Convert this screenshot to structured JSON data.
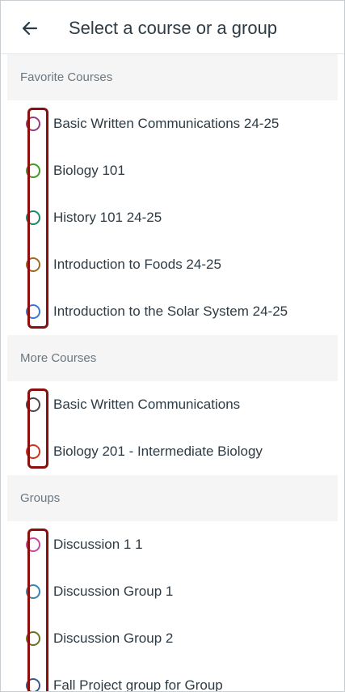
{
  "header": {
    "title": "Select a course or a group"
  },
  "sections": [
    {
      "title": "Favorite Courses",
      "items": [
        {
          "label": "Basic Written Communications 24-25",
          "color": "#8f3f7c"
        },
        {
          "label": "Biology 101",
          "color": "#3f9a2a"
        },
        {
          "label": "History 101 24-25",
          "color": "#198a6e"
        },
        {
          "label": "Introduction to Foods 24-25",
          "color": "#9b6b22"
        },
        {
          "label": "Introduction to the Solar System  24-25",
          "color": "#3a7ad4"
        }
      ]
    },
    {
      "title": "More Courses",
      "items": [
        {
          "label": "Basic Written Communications",
          "color": "#46464e"
        },
        {
          "label": "Biology 201 - Intermediate Biology",
          "color": "#c9381e"
        }
      ]
    },
    {
      "title": "Groups",
      "items": [
        {
          "label": "Discussion 1 1",
          "color": "#c34aa0"
        },
        {
          "label": "Discussion Group 1",
          "color": "#3a84b0"
        },
        {
          "label": "Discussion Group 2",
          "color": "#6a7420"
        },
        {
          "label": "Fall Project group for Group",
          "color": "#3a5a8c"
        }
      ]
    }
  ],
  "icons": {
    "back": "arrow-left-icon"
  },
  "colors": {
    "highlight": "#8b0f0f",
    "section_bg": "#f5f5f5"
  }
}
